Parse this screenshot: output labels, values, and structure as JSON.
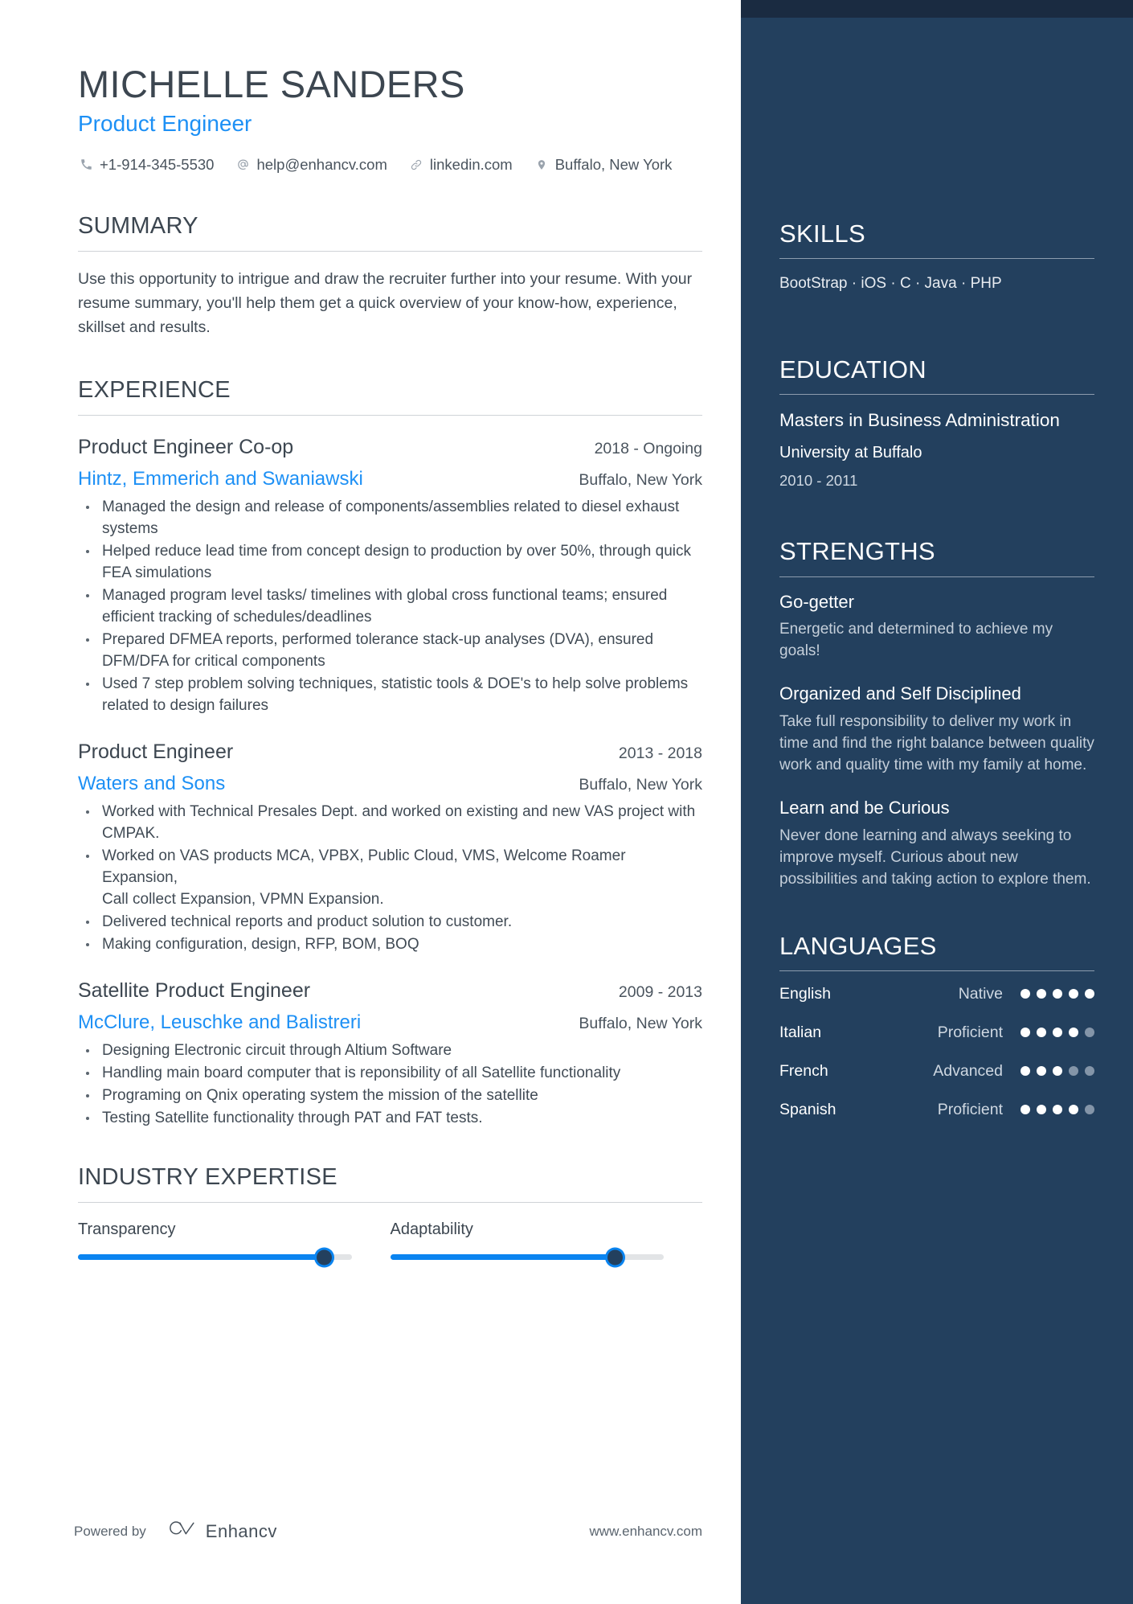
{
  "header": {
    "name": "MICHELLE SANDERS",
    "role": "Product Engineer",
    "contact": {
      "phone": "+1-914-345-5530",
      "email": "help@enhancv.com",
      "website": "linkedin.com",
      "location": "Buffalo, New York"
    }
  },
  "summary": {
    "heading": "SUMMARY",
    "text": "Use this opportunity to intrigue and draw the recruiter further into your resume. With your resume summary, you'll help them get a quick overview of your know-how, experience, skillset and results."
  },
  "experience": {
    "heading": "EXPERIENCE",
    "jobs": [
      {
        "title": "Product Engineer Co-op",
        "dates": "2018 - Ongoing",
        "company": "Hintz, Emmerich and Swaniawski",
        "location": "Buffalo, New York",
        "bullets": [
          "Managed the design and release of components/assemblies related to diesel exhaust systems",
          "Helped reduce lead time from concept design to production by over 50%, through quick FEA simulations",
          "Managed program level tasks/ timelines with global cross functional teams; ensured efficient tracking of schedules/deadlines",
          "Prepared DFMEA reports,  performed tolerance stack-up analyses (DVA), ensured DFM/DFA for critical components",
          "Used 7 step problem solving techniques, statistic tools & DOE's to help solve problems related to design failures"
        ]
      },
      {
        "title": "Product Engineer",
        "dates": "2013 - 2018",
        "company": "Waters and Sons",
        "location": "Buffalo, New York",
        "bullets": [
          "Worked with Technical Presales Dept. and worked on existing and new VAS project with\nCMPAK.",
          "Worked on VAS products MCA, VPBX, Public Cloud, VMS, Welcome Roamer Expansion,\nCall collect Expansion, VPMN Expansion.",
          "Delivered technical reports and product solution to customer.",
          "Making configuration, design, RFP, BOM, BOQ"
        ]
      },
      {
        "title": "Satellite Product Engineer",
        "dates": "2009 - 2013",
        "company": "McClure, Leuschke and Balistreri",
        "location": "Buffalo, New York",
        "bullets": [
          "Designing Electronic circuit through Altium Software",
          "Handling main board computer that is reponsibility of all Satellite functionality",
          "Programing on Qnix operating system the mission of the satellite",
          "Testing Satellite functionality through PAT and FAT tests."
        ]
      }
    ]
  },
  "industry_expertise": {
    "heading": "INDUSTRY EXPERTISE",
    "items": [
      {
        "label": "Transparency",
        "percent": 90
      },
      {
        "label": "Adaptability",
        "percent": 82
      }
    ]
  },
  "skills": {
    "heading": "SKILLS",
    "list": "BootStrap · iOS ·  C  · Java · PHP"
  },
  "education": {
    "heading": "EDUCATION",
    "entries": [
      {
        "degree": "Masters in Business Administration",
        "school": "University at Buffalo",
        "dates": "2010 - 2011"
      }
    ]
  },
  "strengths": {
    "heading": "STRENGTHS",
    "items": [
      {
        "title": "Go-getter",
        "description": "Energetic and determined to achieve my goals!"
      },
      {
        "title": "Organized and Self Disciplined",
        "description": "Take full responsibility to deliver my work in time and find the right balance between quality work and quality time with my family at home."
      },
      {
        "title": "Learn and be Curious",
        "description": "Never done learning and always seeking to improve myself. Curious about new possibilities and taking action to explore them."
      }
    ]
  },
  "languages": {
    "heading": "LANGUAGES",
    "items": [
      {
        "name": "English",
        "level": "Native",
        "dots": 5,
        "total": 5
      },
      {
        "name": "Italian",
        "level": "Proficient",
        "dots": 4,
        "total": 5
      },
      {
        "name": "French",
        "level": "Advanced",
        "dots": 3,
        "total": 5
      },
      {
        "name": "Spanish",
        "level": "Proficient",
        "dots": 4,
        "total": 5
      }
    ]
  },
  "footer": {
    "powered_by": "Powered by",
    "brand": "Enhancv",
    "url": "www.enhancv.com"
  },
  "colors": {
    "accent_blue": "#1d90f5",
    "sidebar_navy": "#23405e",
    "sidebar_top": "#1a2b41",
    "text_dark": "#3c4650",
    "slider_blue": "#0a84f0"
  }
}
